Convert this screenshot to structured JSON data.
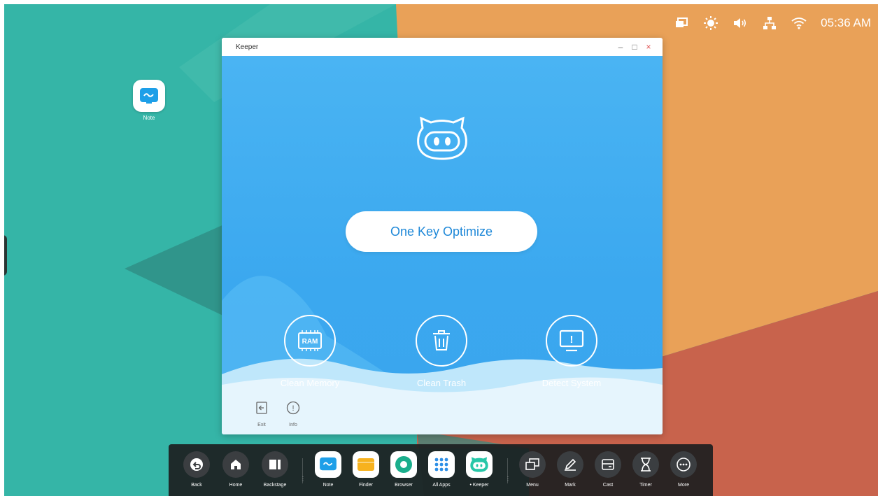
{
  "status_bar": {
    "icons": [
      "screen-mirror-icon",
      "brightness-icon",
      "volume-icon",
      "network-icon",
      "wifi-icon"
    ],
    "time": "05:36 AM"
  },
  "desktop": {
    "icons": [
      {
        "label": "Note",
        "icon": "note-app-icon"
      }
    ]
  },
  "window": {
    "title": "Keeper",
    "controls": [
      "–",
      "□",
      "×"
    ],
    "optimize_label": "One Key Optimize",
    "features": [
      {
        "label": "Clean Memory",
        "icon": "ram-icon",
        "icon_text": "RAM"
      },
      {
        "label": "Clean Trash",
        "icon": "trash-icon"
      },
      {
        "label": "Detect System",
        "icon": "monitor-alert-icon",
        "icon_text": "!"
      }
    ],
    "bottom_actions": [
      {
        "label": "Exit",
        "icon": "exit-icon"
      },
      {
        "label": "Info",
        "icon": "info-icon",
        "icon_text": "!"
      }
    ]
  },
  "dock": {
    "items": [
      {
        "label": "Back",
        "icon": "back-icon"
      },
      {
        "label": "Home",
        "icon": "home-icon"
      },
      {
        "label": "Backstage",
        "icon": "backstage-icon"
      },
      {
        "label": "Note",
        "icon": "note-app-icon"
      },
      {
        "label": "Finder",
        "icon": "finder-icon"
      },
      {
        "label": "Browser",
        "icon": "browser-icon"
      },
      {
        "label": "All Apps",
        "icon": "all-apps-icon"
      },
      {
        "label": "Keeper",
        "icon": "keeper-icon",
        "active": true
      },
      {
        "label": "Menu",
        "icon": "menu-icon"
      },
      {
        "label": "Mark",
        "icon": "mark-pen-icon"
      },
      {
        "label": "Cast",
        "icon": "cast-icon"
      },
      {
        "label": "Timer",
        "icon": "timer-icon"
      },
      {
        "label": "More",
        "icon": "more-icon"
      }
    ]
  },
  "colors": {
    "window_blue": "#3ba8ef",
    "button_text": "#1e88d8",
    "dock_bg": "#1c1e20",
    "wallpaper_teal": "#35b5a7",
    "wallpaper_orange": "#e9a158",
    "wallpaper_red": "#c8634c"
  }
}
